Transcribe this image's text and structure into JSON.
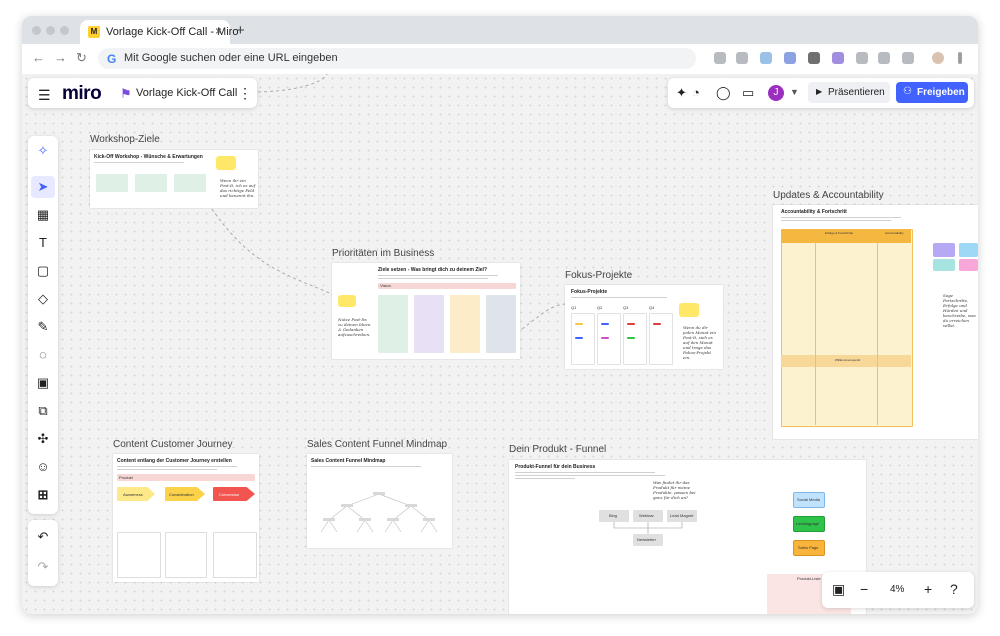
{
  "browser": {
    "tab_title": "Vorlage Kick-Off Call - Miro",
    "tab_close": "×",
    "new_tab": "+",
    "favicon": "M",
    "omnibox_placeholder": "Mit Google suchen oder eine URL eingeben",
    "google_g": "G",
    "nav": {
      "back": "←",
      "forward": "→",
      "reload": "↻"
    }
  },
  "miro": {
    "menu_icon": "☰",
    "logo": "miro",
    "board_title": "Vorlage Kick-Off Call",
    "kebab": "⋮",
    "avatar_letter": "J",
    "present_label": "Präsentieren",
    "share_label": "Freigeben",
    "zoom_level": "4%"
  },
  "frames": {
    "workshop": {
      "label": "Workshop-Ziele",
      "heading": "Kick-Off Workshop - Wünsche & Erwartungen",
      "note": "Wenn ihr ein Post-It, ich es auf das richtige Feld und benennt ihn."
    },
    "priorities": {
      "label": "Prioritäten im Business",
      "heading": "Ziele setzen - Was bringt dich zu deinem Ziel?",
      "vision": "Vision",
      "note": "Nutze Post-Its zu deinen Ideen & Gedanken aufzuschreiben."
    },
    "fokus": {
      "label": "Fokus-Projekte",
      "heading": "Fokus-Projekte",
      "quarters": [
        "Q1",
        "Q2",
        "Q3",
        "Q4"
      ],
      "note": "Wenn du dir jeden Monat ein Post-It, sieh es auf den Monat und trage das Fokus-Projekt ein."
    },
    "updates": {
      "label": "Updates & Accountability",
      "heading": "Accountability & Fortschritt",
      "col1": "Erfolge & Fortschritte",
      "col2": "Accountability",
      "mid": "Willkommenspunkt",
      "note": "Sage Fortschritte, Erfolge und Hürden und beschreibe, was du erreichen willst."
    },
    "customer": {
      "label": "Content Customer Journey",
      "heading": "Content entlang der Customer Journey erstellen",
      "produkt": "Produkt",
      "arrows": [
        "Awareness",
        "Consideration",
        "Conversion"
      ]
    },
    "funnel": {
      "label": "Sales Content Funnel Mindmap",
      "heading": "Sales Content Funnel Mindmap"
    },
    "produkt_funnel": {
      "label": "Dein Produkt - Funnel",
      "heading": "Produkt-Funnel für dein Business",
      "note": "Was findet ihr das Produkt für meine Produkte, passen bei ganz für dich an?",
      "boxes": [
        "Blog",
        "Webinar",
        "Lead Magnet",
        "Newsletter"
      ],
      "right_boxes": [
        "Social Media",
        "Landingpage",
        "Sales Page"
      ],
      "table_title": "Produkt-Liste"
    }
  },
  "colors": {
    "sticky_yellow": "#ffe867",
    "miro_blue": "#4262ff",
    "green": "#2fc449",
    "orange": "#f8b43b",
    "canvas": "#f2f2f2"
  }
}
